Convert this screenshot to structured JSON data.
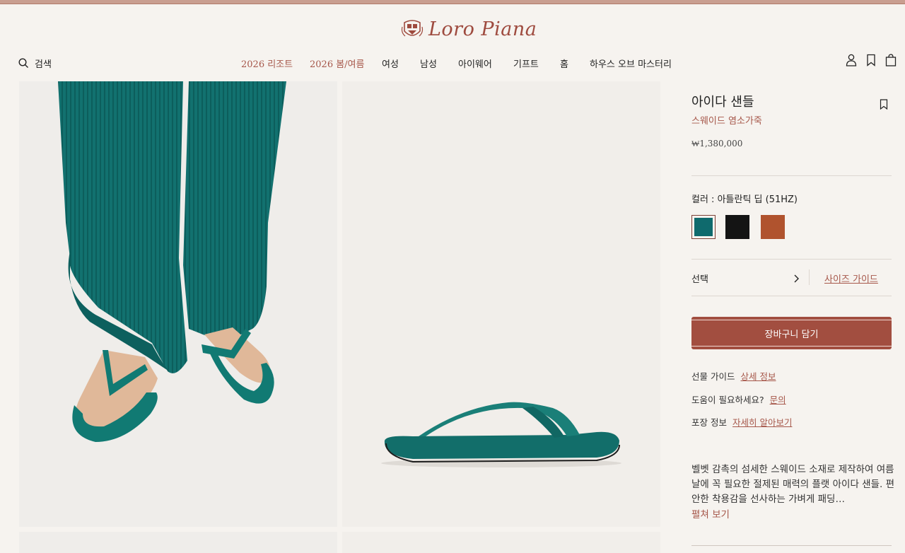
{
  "brand": {
    "name": "Loro Piana"
  },
  "header": {
    "search_label": "검색",
    "nav": [
      {
        "label": "2026 리조트",
        "accent": true
      },
      {
        "label": "2026 봄/여름",
        "accent": true
      },
      {
        "label": "여성"
      },
      {
        "label": "남성"
      },
      {
        "label": "아이웨어"
      },
      {
        "label": "기프트"
      },
      {
        "label": "홈"
      },
      {
        "label": "하우스 오브 마스터리"
      }
    ],
    "icons": [
      "user-icon",
      "bookmark-icon",
      "bag-icon"
    ]
  },
  "product": {
    "title": "아이다 샌들",
    "subtitle": "스웨이드 염소가죽",
    "price": "₩1,380,000",
    "color_label": "컬러 : 아틀란틱 딥 (51HZ)",
    "swatches": [
      {
        "name": "teal",
        "color": "#0f6a6d",
        "selected": true
      },
      {
        "name": "black",
        "color": "#141414",
        "selected": false
      },
      {
        "name": "brown",
        "color": "#b0532e",
        "selected": false
      }
    ],
    "select_label": "선택",
    "size_guide": "사이즈 가이드",
    "cart_button": "장바구니 담기",
    "gift_label": "선물 가이드",
    "gift_link": "상세 정보",
    "help_label": "도움이 필요하세요?",
    "help_link": "문의",
    "packaging_label": "포장 정보",
    "packaging_link": "자세히 알아보기",
    "description": "벨벳 감촉의 섬세한 스웨이드 소재로 제작하여 여름날에 꼭 필요한 절제된 매력의 플랫 아이다 샌들. 편안한 착용감을 선사하는 가벼게 패딩…",
    "expand": "펼쳐 보기"
  },
  "colors": {
    "accent": "#a6574a",
    "button": "#a24e40",
    "product_teal": "#0f6a6d"
  }
}
